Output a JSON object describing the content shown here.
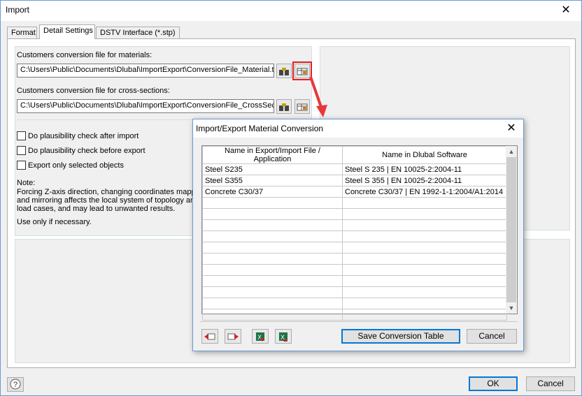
{
  "window": {
    "title": "Import",
    "close_glyph": "✕"
  },
  "tabs": [
    {
      "label": "Format"
    },
    {
      "label": "Detail Settings"
    },
    {
      "label": "DSTV Interface (*.stp)"
    }
  ],
  "materials": {
    "label": "Customers conversion file for materials:",
    "path": "C:\\Users\\Public\\Documents\\Dlubal\\ImportExport\\ConversionFile_Material.txt"
  },
  "cross_sections": {
    "label": "Customers conversion file for cross-sections:",
    "path": "C:\\Users\\Public\\Documents\\Dlubal\\ImportExport\\ConversionFile_CrossSect"
  },
  "options": [
    {
      "label": "Do plausibility check after import",
      "checked": false
    },
    {
      "label": "Do plausibility check before export",
      "checked": false
    },
    {
      "label": "Export only selected objects",
      "checked": false
    }
  ],
  "note": {
    "title": "Note:",
    "line1": "Forcing Z-axis direction, changing coordinates mappin",
    "line2": "and mirroring affects the local system of topology an",
    "line3": "load cases, and may lead to unwanted results.",
    "line4": "Use only if necessary."
  },
  "footer": {
    "ok": "OK",
    "cancel": "Cancel"
  },
  "dialog": {
    "title": "Import/Export Material Conversion",
    "close_glyph": "✕",
    "columns": [
      "Name in Export/Import File / Application",
      "Name in Dlubal Software"
    ],
    "rows": [
      [
        "Steel S235",
        "Steel S 235 | EN 10025-2:2004-11"
      ],
      [
        "Steel S355",
        "Steel S 355 | EN 10025-2:2004-11"
      ],
      [
        "Concrete C30/37",
        "Concrete C30/37 | EN 1992-1-1:2004/A1:2014"
      ]
    ],
    "empty_rows": 11,
    "save_label": "Save Conversion Table",
    "cancel_label": "Cancel"
  },
  "colors": {
    "highlight": "#e02020",
    "arrow": "#e8373a",
    "accent": "#0078d7"
  }
}
